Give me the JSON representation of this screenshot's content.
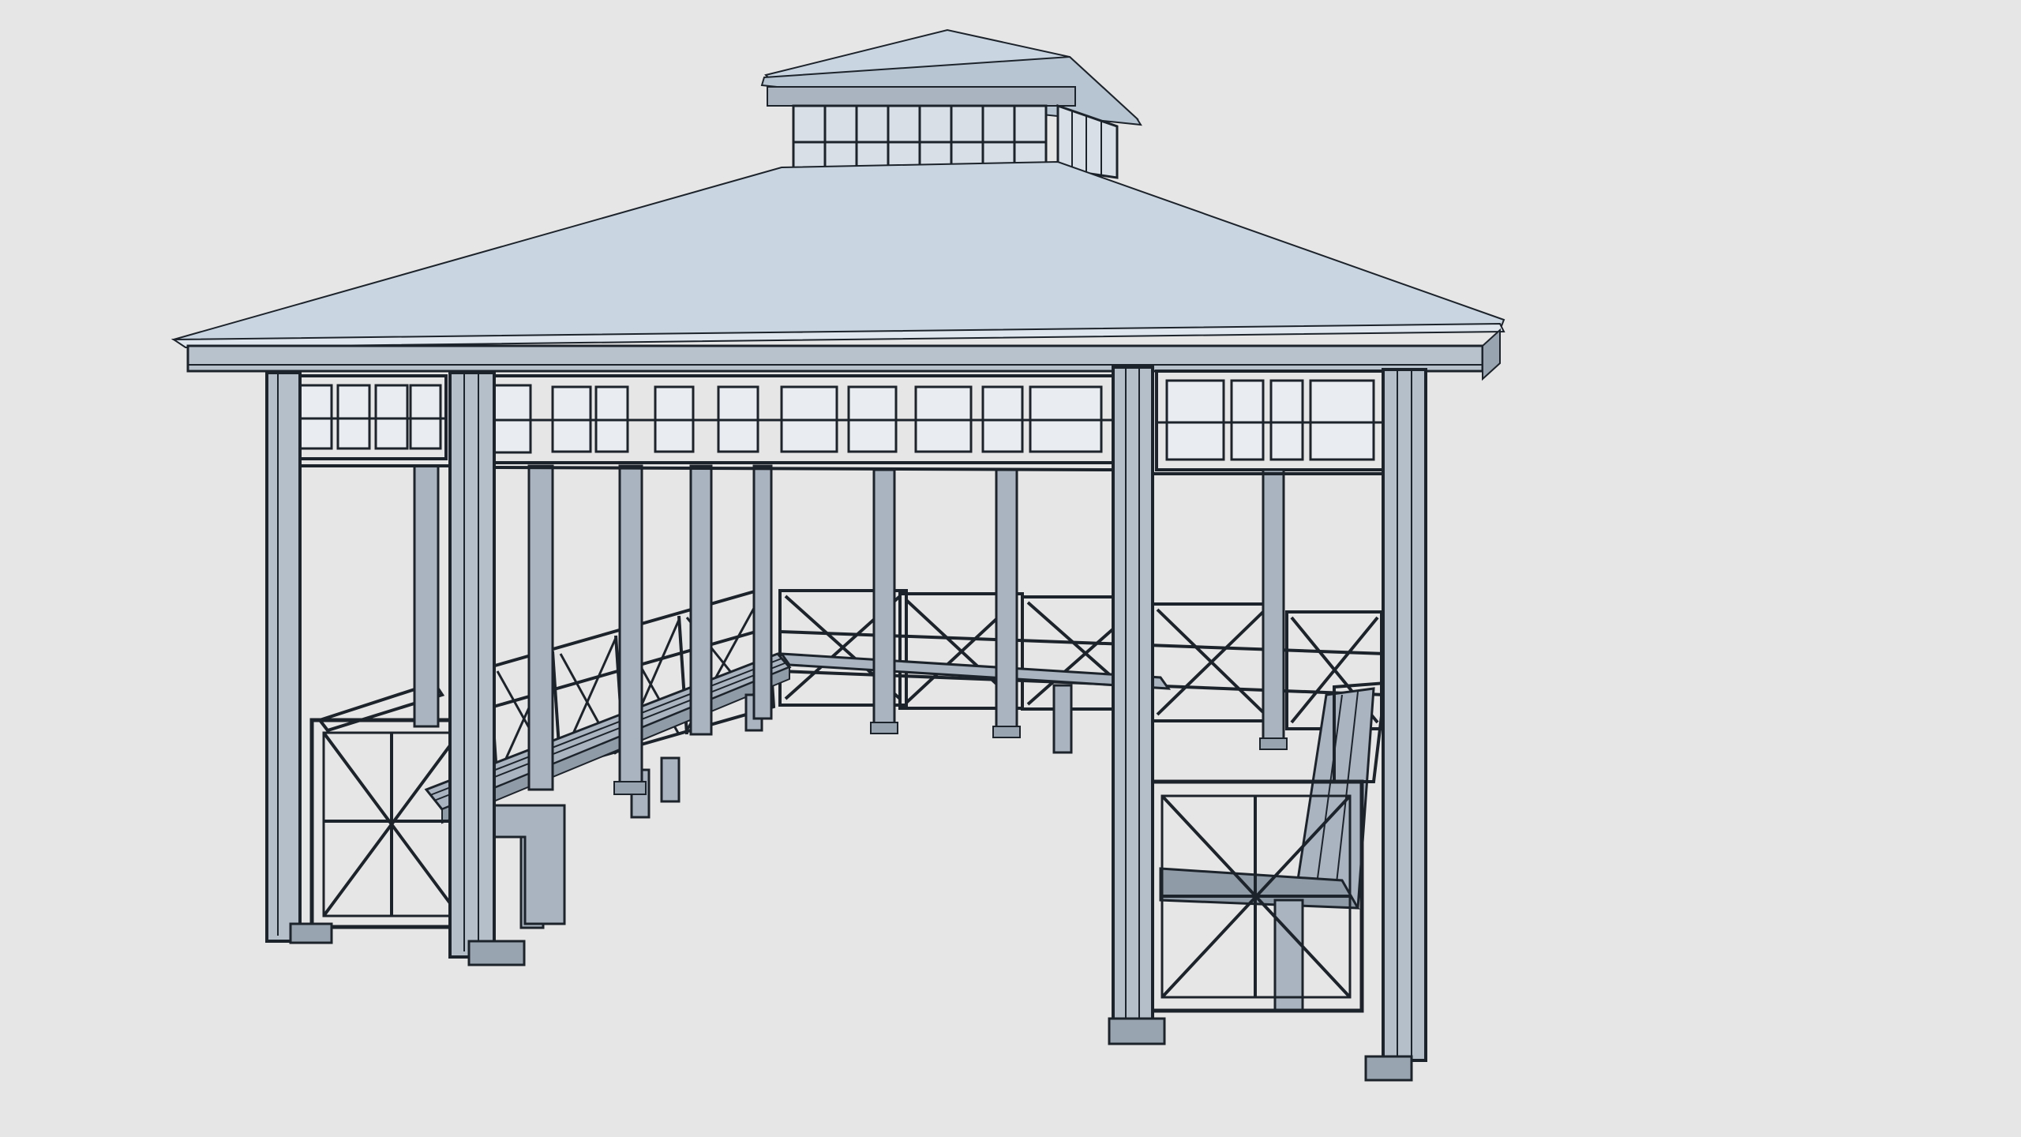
{
  "scene": {
    "subject": "gazebo-3d-model-wireframe-render",
    "colors": {
      "background": "#e6e6e6",
      "roof": "#c9d6e2",
      "roof_shade": "#b7c5d2",
      "structure": "#a9b4c0",
      "outline": "#1d232a",
      "glass": "#d8dfe6"
    }
  }
}
